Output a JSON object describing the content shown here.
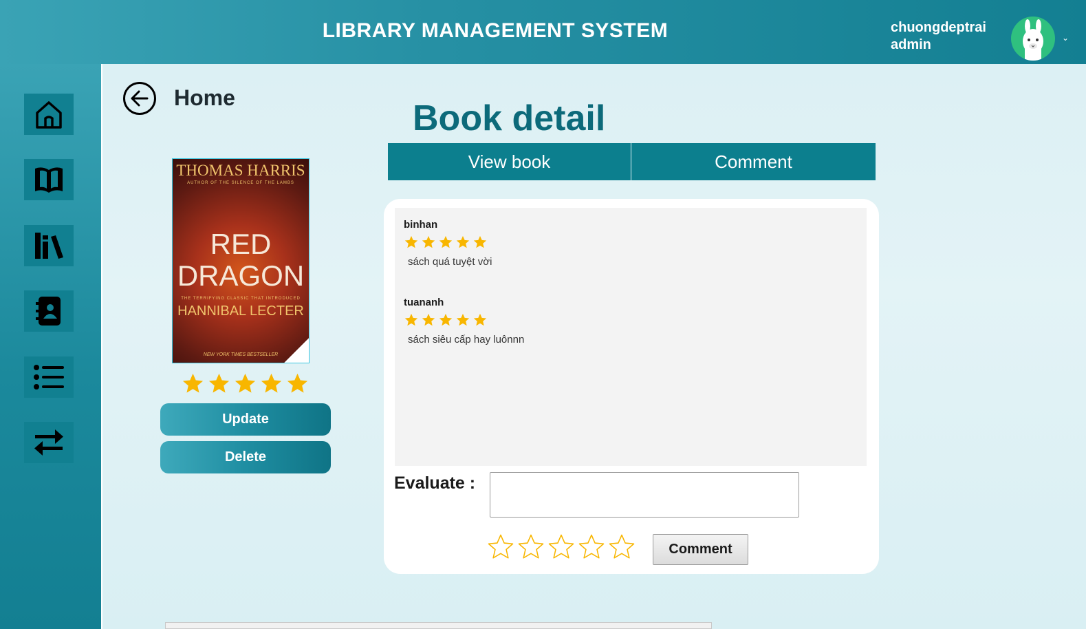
{
  "header": {
    "app_title": "LIBRARY MANAGEMENT SYSTEM",
    "username": "chuongdeptrai",
    "role": "admin",
    "brand_color": "#137f92"
  },
  "sidebar": {
    "items": [
      {
        "icon": "home-icon"
      },
      {
        "icon": "book-open-icon"
      },
      {
        "icon": "books-shelf-icon"
      },
      {
        "icon": "contact-book-icon"
      },
      {
        "icon": "list-icon"
      },
      {
        "icon": "transfer-arrows-icon"
      }
    ]
  },
  "breadcrumb": {
    "back_label": "Home"
  },
  "page": {
    "title": "Book detail"
  },
  "book": {
    "cover": {
      "author": "THOMAS HARRIS",
      "tagline_top": "AUTHOR OF THE SILENCE OF THE LAMBS",
      "title_line1": "RED",
      "title_line2": "DRAGON",
      "tagline_bottom": "THE TERRIFYING CLASSIC THAT INTRODUCED",
      "subject": "HANNIBAL LECTER",
      "footer": "NEW YORK TIMES BESTSELLER"
    },
    "rating": 5,
    "rating_max": 5,
    "update_label": "Update",
    "delete_label": "Delete"
  },
  "tabs": [
    {
      "label": "View book"
    },
    {
      "label": "Comment"
    }
  ],
  "comments": [
    {
      "user": "binhan",
      "rating": 5,
      "text": "sách quá tuyệt vời"
    },
    {
      "user": "tuananh",
      "rating": 5,
      "text": "sách siêu cấp hay luônnn"
    }
  ],
  "evaluate": {
    "label": "Evaluate :",
    "value": "",
    "rating": 0,
    "rating_max": 5,
    "submit_label": "Comment"
  },
  "colors": {
    "star": "#f8b600",
    "tab": "#0c7f8e",
    "title": "#0c6a7a"
  }
}
